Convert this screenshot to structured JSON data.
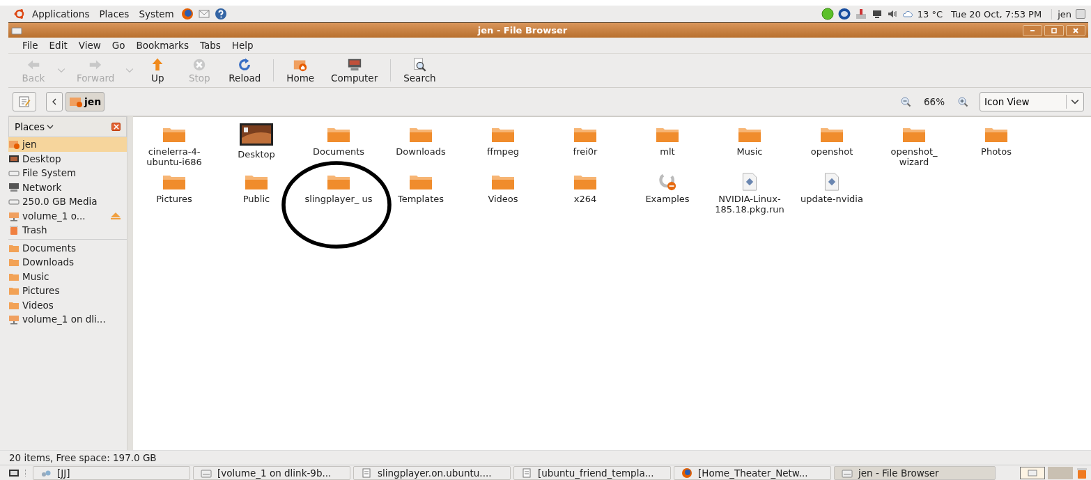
{
  "top_panel": {
    "menus": [
      "Applications",
      "Places",
      "System"
    ],
    "temperature": "13 °C",
    "clock": "Tue 20 Oct,  7:53 PM",
    "user": "jen"
  },
  "window": {
    "title": "jen - File Browser"
  },
  "menu_bar": [
    "File",
    "Edit",
    "View",
    "Go",
    "Bookmarks",
    "Tabs",
    "Help"
  ],
  "toolbar": [
    {
      "label": "Back",
      "kind": "back",
      "disabled": true,
      "dropdown": true,
      "separator_after": false
    },
    {
      "label": "Forward",
      "kind": "forward",
      "disabled": true,
      "dropdown": true,
      "separator_after": false
    },
    {
      "label": "Up",
      "kind": "up",
      "disabled": false,
      "dropdown": false,
      "separator_after": false
    },
    {
      "label": "Stop",
      "kind": "stop",
      "disabled": true,
      "dropdown": false,
      "separator_after": false
    },
    {
      "label": "Reload",
      "kind": "reload",
      "disabled": false,
      "dropdown": false,
      "separator_after": true
    },
    {
      "label": "Home",
      "kind": "home",
      "disabled": false,
      "dropdown": false,
      "separator_after": false
    },
    {
      "label": "Computer",
      "kind": "computer",
      "disabled": false,
      "dropdown": false,
      "separator_after": true
    },
    {
      "label": "Search",
      "kind": "search",
      "disabled": false,
      "dropdown": false,
      "separator_after": false
    }
  ],
  "location": {
    "path_button": "jen",
    "zoom": "66%",
    "view": "Icon View"
  },
  "sidebar": {
    "title": "Places",
    "groups": [
      [
        {
          "label": "jen",
          "kind": "home",
          "selected": true,
          "eject": false
        },
        {
          "label": "Desktop",
          "kind": "desktop",
          "selected": false,
          "eject": false
        },
        {
          "label": "File System",
          "kind": "drive",
          "selected": false,
          "eject": false
        },
        {
          "label": "Network",
          "kind": "network",
          "selected": false,
          "eject": false
        },
        {
          "label": "250.0 GB Media",
          "kind": "drive",
          "selected": false,
          "eject": false
        },
        {
          "label": "volume_1 o...",
          "kind": "share",
          "selected": false,
          "eject": true
        },
        {
          "label": "Trash",
          "kind": "trash",
          "selected": false,
          "eject": false
        }
      ],
      [
        {
          "label": "Documents",
          "kind": "folder",
          "selected": false,
          "eject": false
        },
        {
          "label": "Downloads",
          "kind": "folder",
          "selected": false,
          "eject": false
        },
        {
          "label": "Music",
          "kind": "folder",
          "selected": false,
          "eject": false
        },
        {
          "label": "Pictures",
          "kind": "folder",
          "selected": false,
          "eject": false
        },
        {
          "label": "Videos",
          "kind": "folder",
          "selected": false,
          "eject": false
        },
        {
          "label": "volume_1 on dli...",
          "kind": "share",
          "selected": false,
          "eject": false
        }
      ]
    ]
  },
  "files": [
    {
      "name": "cinelerra-4-ubuntu-i686",
      "kind": "folder"
    },
    {
      "name": "Desktop",
      "kind": "desktop"
    },
    {
      "name": "Documents",
      "kind": "folder"
    },
    {
      "name": "Downloads",
      "kind": "folder"
    },
    {
      "name": "ffmpeg",
      "kind": "folder"
    },
    {
      "name": "frei0r",
      "kind": "folder"
    },
    {
      "name": "mlt",
      "kind": "folder"
    },
    {
      "name": "Music",
      "kind": "folder"
    },
    {
      "name": "openshot",
      "kind": "folder"
    },
    {
      "name": "openshot_ wizard",
      "kind": "folder"
    },
    {
      "name": "Photos",
      "kind": "folder"
    },
    {
      "name": "Pictures",
      "kind": "folder"
    },
    {
      "name": "Public",
      "kind": "folder"
    },
    {
      "name": "slingplayer_ us",
      "kind": "folder"
    },
    {
      "name": "Templates",
      "kind": "folder"
    },
    {
      "name": "Videos",
      "kind": "folder"
    },
    {
      "name": "x264",
      "kind": "folder"
    },
    {
      "name": "Examples",
      "kind": "link"
    },
    {
      "name": "NVIDIA-Linux-185.18.pkg.run",
      "kind": "script"
    },
    {
      "name": "update-nvidia",
      "kind": "script"
    }
  ],
  "status_bar": "20 items, Free space: 197.0 GB",
  "taskbar": [
    {
      "label": "[JJ]",
      "kind": "chat",
      "selected": false
    },
    {
      "label": "[volume_1 on dlink-9b...",
      "kind": "window",
      "selected": false
    },
    {
      "label": "slingplayer.on.ubuntu....",
      "kind": "doc",
      "selected": false
    },
    {
      "label": "[ubuntu_friend_templa...",
      "kind": "doc",
      "selected": false
    },
    {
      "label": "[Home_Theater_Netw...",
      "kind": "browser",
      "selected": false
    },
    {
      "label": "jen - File Browser",
      "kind": "window",
      "selected": true
    }
  ]
}
